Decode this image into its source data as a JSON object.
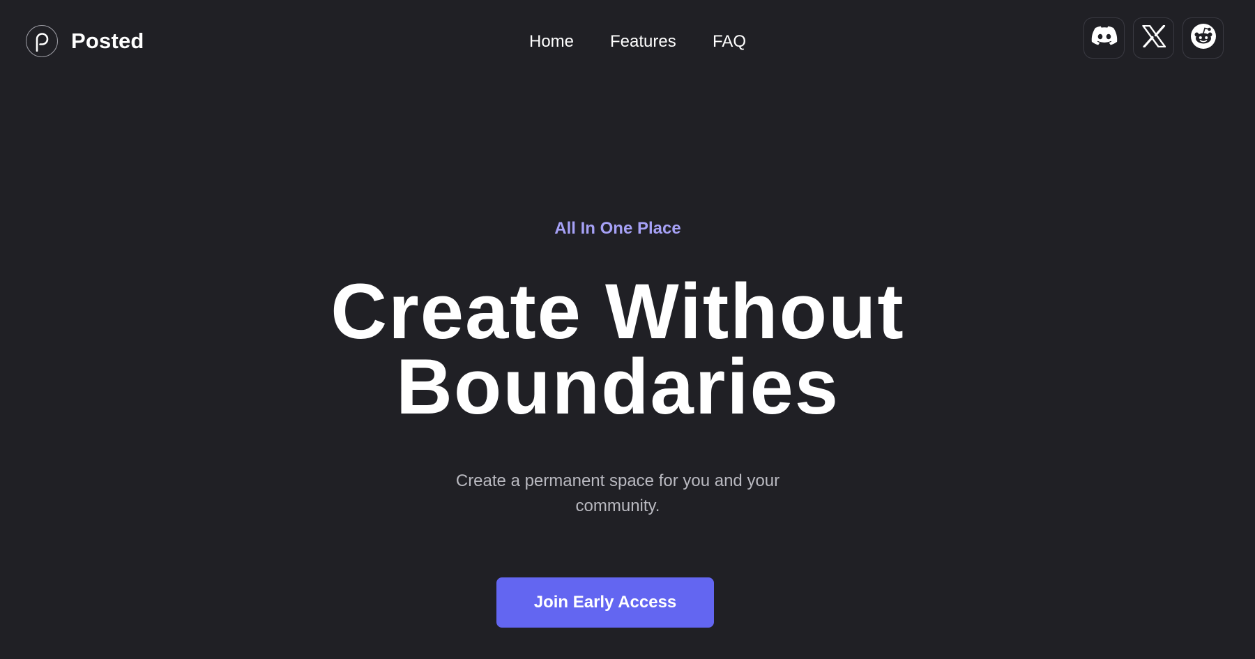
{
  "header": {
    "brand_name": "Posted",
    "nav": [
      {
        "label": "Home"
      },
      {
        "label": "Features"
      },
      {
        "label": "FAQ"
      }
    ],
    "socials": [
      {
        "icon": "discord-icon"
      },
      {
        "icon": "x-icon"
      },
      {
        "icon": "reddit-icon"
      }
    ]
  },
  "hero": {
    "eyebrow": "All In One Place",
    "headline_line1": "Create Without",
    "headline_line2": "Boundaries",
    "subtitle_line1": "Create a permanent space for you and your",
    "subtitle_line2": "community.",
    "cta_label": "Join Early Access"
  },
  "colors": {
    "background": "#202025",
    "accent": "#6366f1",
    "eyebrow": "#a6a1f6",
    "subtitle": "#b9b9c0"
  }
}
